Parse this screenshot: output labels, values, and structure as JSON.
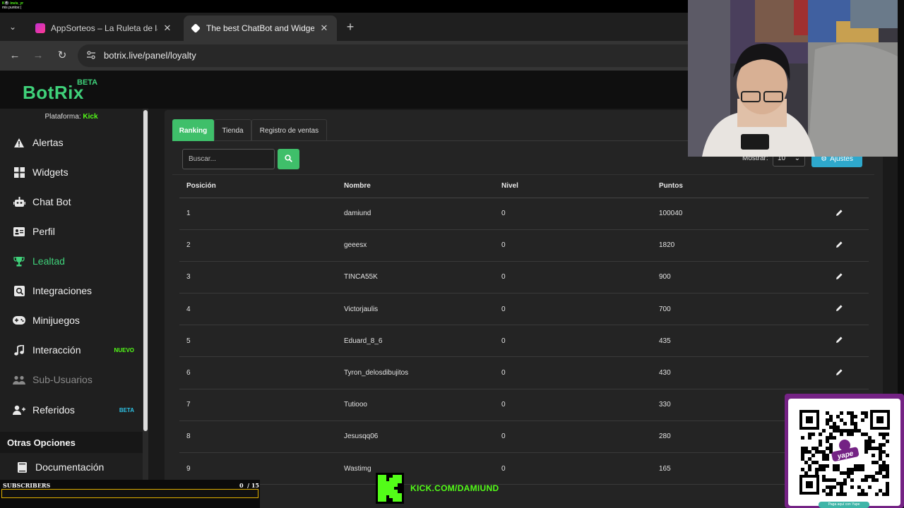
{
  "overlay_top": {
    "line1": "K🎱 invis_yr",
    "line2": "mis puntos:("
  },
  "browser": {
    "tabs": [
      {
        "title": "AppSorteos – La Ruleta de la Suerte",
        "active": false
      },
      {
        "title": "The best ChatBot and Widgets for Kick",
        "active": true
      }
    ],
    "url": "botrix.live/panel/loyalty"
  },
  "app": {
    "logo": "BotRix",
    "logo_badge": "BETA",
    "platform_label": "Plataforma:",
    "platform_value": "Kick"
  },
  "sidebar": {
    "items": [
      {
        "label": "Alertas",
        "icon": "warning-icon"
      },
      {
        "label": "Widgets",
        "icon": "grid-icon"
      },
      {
        "label": "Chat Bot",
        "icon": "robot-icon"
      },
      {
        "label": "Perfil",
        "icon": "id-card-icon"
      },
      {
        "label": "Lealtad",
        "icon": "trophy-icon",
        "active": true
      },
      {
        "label": "Integraciones",
        "icon": "integrations-icon"
      },
      {
        "label": "Minijuegos",
        "icon": "gamepad-icon"
      },
      {
        "label": "Interacción",
        "icon": "music-icon",
        "tag": "NUEVO"
      },
      {
        "label": "Sub-Usuarios",
        "icon": "users-icon",
        "disabled": true
      },
      {
        "label": "Referidos",
        "icon": "user-plus-icon",
        "tag": "BETA"
      }
    ],
    "section_title": "Otras Opciones",
    "other_items": [
      {
        "label": "Documentación",
        "icon": "book-icon"
      }
    ]
  },
  "content": {
    "tabs": [
      "Ranking",
      "Tienda",
      "Registro de ventas"
    ],
    "search_placeholder": "Buscar...",
    "show_label": "Mostrar:",
    "show_value": "10",
    "settings_label": "Ajustes",
    "table": {
      "headers": [
        "Posición",
        "Nombre",
        "Nivel",
        "Puntos"
      ],
      "rows": [
        [
          "1",
          "damiund",
          "0",
          "100040"
        ],
        [
          "2",
          "geeesx",
          "0",
          "1820"
        ],
        [
          "3",
          "TINCA55K",
          "0",
          "900"
        ],
        [
          "4",
          "Victorjaulis",
          "0",
          "700"
        ],
        [
          "5",
          "Eduard_8_6",
          "0",
          "435"
        ],
        [
          "6",
          "Tyron_delosdibujitos",
          "0",
          "430"
        ],
        [
          "7",
          "Tutiooo",
          "0",
          "330"
        ],
        [
          "8",
          "Jesusqq06",
          "0",
          "280"
        ],
        [
          "9",
          "Wastimg",
          "0",
          "165"
        ]
      ]
    }
  },
  "stream_overlay": {
    "subscribers_label": "SUBSCRIBERS",
    "subscribers_count": "0",
    "subscribers_goal": "/ 15",
    "subscribers_progress": 0,
    "kick_url": "KICK.COM/DAMIUND",
    "qr_caption": "Paga aquí con Yape",
    "qr_brand": "yape"
  },
  "colors": {
    "accent_green": "#3fbf6a",
    "kick_green": "#53fc18",
    "info_blue": "#2ea8cc",
    "yape_purple": "#742284"
  }
}
